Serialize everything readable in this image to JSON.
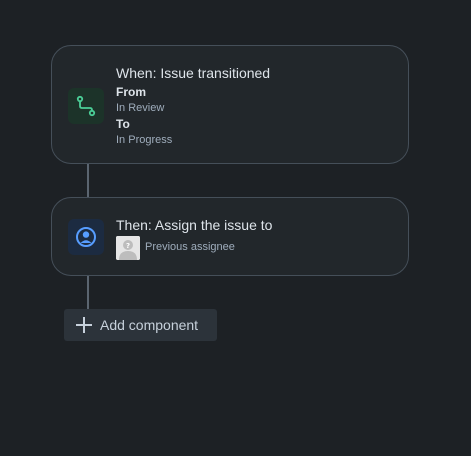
{
  "colors": {
    "background": "#1d2125",
    "card_background": "#22272b",
    "card_border": "#454f59",
    "trigger_icon_tile": "#1c3329",
    "trigger_icon_stroke": "#4bce97",
    "action_icon_tile": "#1c2b41",
    "action_icon_fill": "#579dff",
    "primary_text": "#dee4ea",
    "secondary_text": "#9fadbc",
    "connector": "#5b6570",
    "add_button_background": "#2c333a"
  },
  "trigger": {
    "icon": "branch-transition-icon",
    "title": "When: Issue transitioned",
    "from_label": "From",
    "from_value": "In Review",
    "to_label": "To",
    "to_value": "In Progress"
  },
  "action": {
    "icon": "user-avatar-circle-icon",
    "title": "Then: Assign the issue to",
    "assignee_avatar": "default-avatar-icon",
    "assignee_name": "Previous assignee"
  },
  "add_component": {
    "icon": "plus-icon",
    "label": "Add component"
  }
}
